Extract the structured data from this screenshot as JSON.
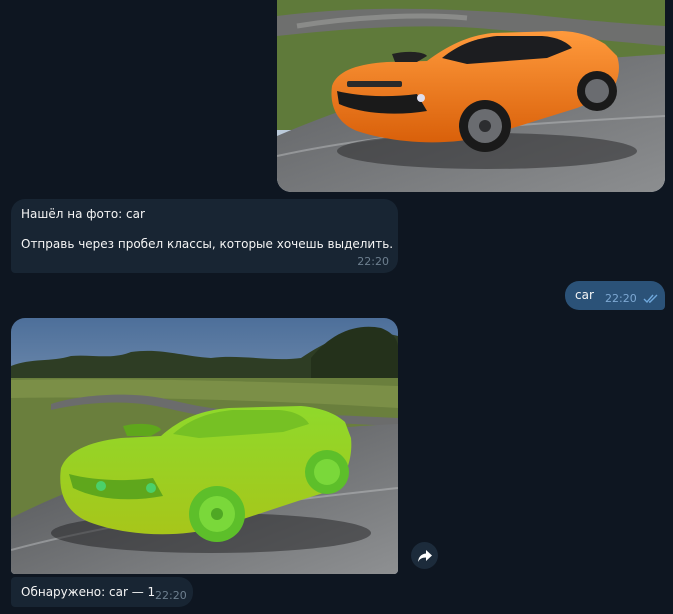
{
  "messages": {
    "incoming_text": {
      "line1": "Нашёл на фото: car",
      "line2": "Отправь через пробел классы, которые хочешь выделить.",
      "time": "22:20"
    },
    "outgoing_text": {
      "text": "car",
      "time": "22:20"
    },
    "incoming_caption": {
      "text": "Обнаружено: car — 1",
      "time": "22:20"
    }
  },
  "icons": {
    "read_receipt": "double-check-icon",
    "share": "share-arrow-icon"
  },
  "colors": {
    "background": "#0e1621",
    "incoming_bubble": "#182533",
    "outgoing_bubble": "#2b5278",
    "car_original": "#f07a12",
    "segmentation_mask": "#7ed321"
  }
}
